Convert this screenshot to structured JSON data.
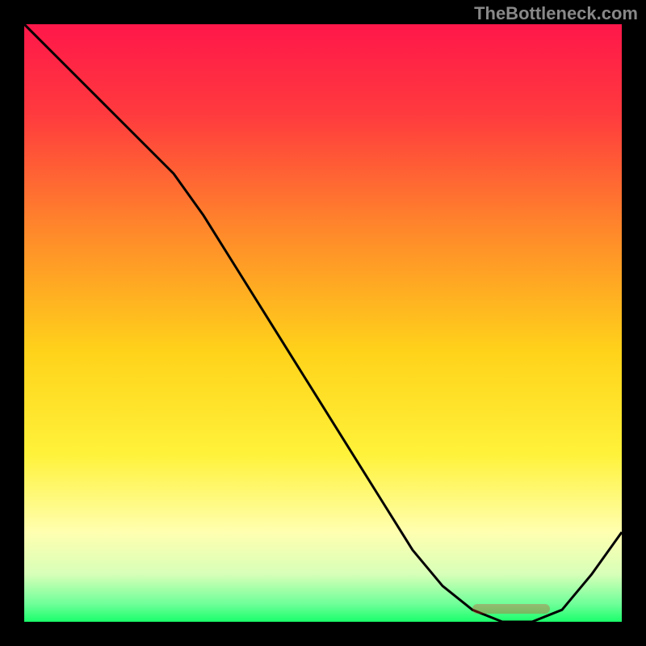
{
  "watermark": "TheBottleneck.com",
  "chart_data": {
    "type": "line",
    "title": "",
    "xlabel": "",
    "ylabel": "",
    "x": [
      0,
      5,
      10,
      15,
      20,
      25,
      30,
      35,
      40,
      45,
      50,
      55,
      60,
      65,
      70,
      75,
      80,
      85,
      90,
      95,
      100
    ],
    "y": [
      100,
      95,
      90,
      85,
      80,
      75,
      68,
      60,
      52,
      44,
      36,
      28,
      20,
      12,
      6,
      2,
      0,
      0,
      2,
      8,
      15
    ],
    "xlim": [
      0,
      100
    ],
    "ylim": [
      0,
      100
    ],
    "gradient_stops": [
      {
        "pos": 0,
        "color": "#ff174a"
      },
      {
        "pos": 0.15,
        "color": "#ff3a3e"
      },
      {
        "pos": 0.35,
        "color": "#ff8a2a"
      },
      {
        "pos": 0.55,
        "color": "#ffd31a"
      },
      {
        "pos": 0.72,
        "color": "#fff23a"
      },
      {
        "pos": 0.85,
        "color": "#ffffb0"
      },
      {
        "pos": 0.92,
        "color": "#d8ffb8"
      },
      {
        "pos": 0.97,
        "color": "#6fff9a"
      },
      {
        "pos": 1.0,
        "color": "#1aff6a"
      }
    ],
    "optimal_region": {
      "x_start": 75,
      "x_end": 88,
      "label": ""
    }
  }
}
